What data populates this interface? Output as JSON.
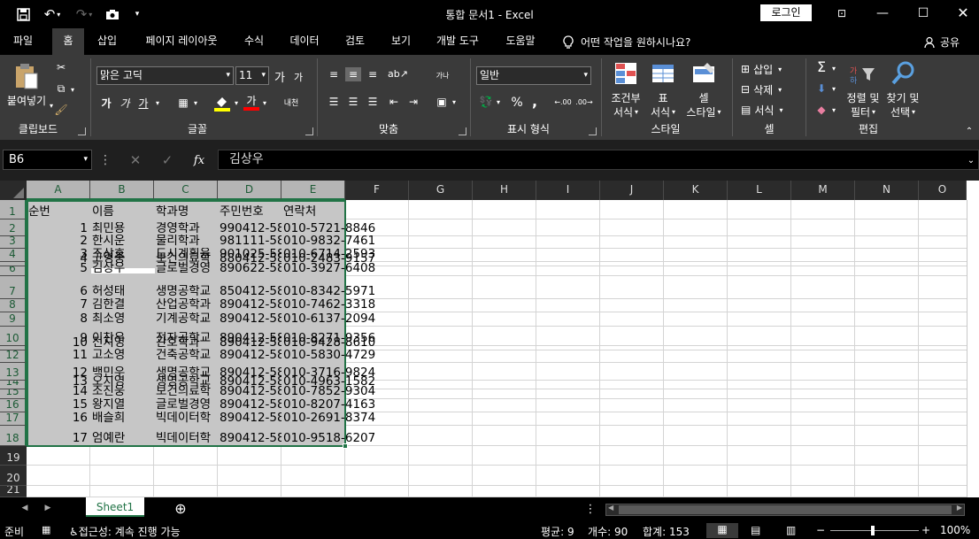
{
  "titlebar": {
    "title": "통합 문서1  -  Excel",
    "login": "로그인",
    "icons": [
      "save-icon",
      "undo-icon",
      "redo-icon",
      "camera-icon",
      "customize-qat-icon",
      "ribbon-display-icon",
      "minimize-icon",
      "maximize-icon",
      "close-icon"
    ]
  },
  "tabs": [
    "파일",
    "홈",
    "삽입",
    "페이지 레이아웃",
    "수식",
    "데이터",
    "검토",
    "보기",
    "개발 도구",
    "도움말"
  ],
  "active_tab": "홈",
  "tellme": "어떤 작업을 원하시나요?",
  "share": "공유",
  "ribbon": {
    "clipboard": {
      "paste": "붙여넣기",
      "label": "클립보드"
    },
    "font": {
      "name": "맑은 고딕",
      "size": "11",
      "label": "글꼴",
      "grow": "가",
      "shrink": "가",
      "bold": "가",
      "italic": "가",
      "underline": "가",
      "fontcolor": "가",
      "phonetic": "내천"
    },
    "alignment": {
      "label": "맞춤",
      "wrap": "가나"
    },
    "number": {
      "format": "일반",
      "label": "표시 형식",
      "percent": "%",
      "comma": ","
    },
    "styles": {
      "label": "스타일",
      "conditional": [
        "조건부",
        "서식"
      ],
      "table": [
        "표",
        "서식"
      ],
      "cellstyle": [
        "셀",
        "스타일"
      ]
    },
    "cells": {
      "label": "셀",
      "insert": "삽입",
      "delete": "삭제",
      "format": "서식"
    },
    "editing": {
      "label": "편집",
      "sortfilter": [
        "정렬 및",
        "필터"
      ],
      "findselect": [
        "찾기 및",
        "선택"
      ]
    },
    "accent": "#217346"
  },
  "formula_bar": {
    "namebox": "B6",
    "fx": "fx",
    "content": "김상우"
  },
  "grid": {
    "columns": [
      "A",
      "B",
      "C",
      "D",
      "E",
      "F",
      "G",
      "H",
      "I",
      "J",
      "K",
      "L",
      "M",
      "N",
      "O"
    ],
    "rows": [
      "1",
      "2",
      "3",
      "4",
      "5",
      "6",
      "7",
      "8",
      "9",
      "10",
      "11",
      "12",
      "13",
      "14",
      "15",
      "16",
      "17",
      "18",
      "19",
      "20",
      "21"
    ],
    "cells": [
      {
        "row": 1,
        "a": "순번",
        "b": "이름",
        "c": "학과명",
        "d": "주민번호",
        "e": "연락처"
      },
      {
        "row": 2,
        "a": "1",
        "b": "최민용",
        "c": "경영학과",
        "d": "990412-58",
        "e": "010-5721-8846"
      },
      {
        "row": 3,
        "a": "2",
        "b": "한시운",
        "c": "물리학과",
        "d": "981111-58",
        "e": "010-9832-7461"
      },
      {
        "row": 4,
        "a": "3",
        "b": "조상호",
        "c": "도시계획융",
        "d": "901025-58",
        "e": "010-6714-2593"
      },
      {
        "row": 5,
        "a": "4",
        "b": "고영중",
        "c": "보건의료학",
        "d": "880412-58",
        "e": "010-2483-9157"
      },
      {
        "row": 6,
        "a": "5",
        "b": "김상우",
        "c": "글로벌경영",
        "d": "890622-58",
        "e": "010-3927-6408"
      },
      {
        "row": 7,
        "a": "6",
        "b": "허성태",
        "c": "생명공학교",
        "d": "850412-58",
        "e": "010-8342-5971"
      },
      {
        "row": 8,
        "a": "7",
        "b": "김한결",
        "c": "산업공학과",
        "d": "890412-58",
        "e": "010-7462-3318"
      },
      {
        "row": 9,
        "a": "8",
        "b": "최소영",
        "c": "기계공학교",
        "d": "890412-58",
        "e": "010-6137-2094"
      },
      {
        "row": 10,
        "a": "9",
        "b": "이찬우",
        "c": "전자공학교",
        "d": "890412-58",
        "e": "010-8271-9356"
      },
      {
        "row": 11,
        "a": "10",
        "b": "전지영",
        "c": "간호학과",
        "d": "890412-58",
        "e": "010-9428-8610"
      },
      {
        "row": 12,
        "a": "11",
        "b": "고소영",
        "c": "건축공학교",
        "d": "890412-58",
        "e": "010-5830-4729"
      },
      {
        "row": 13,
        "a": "12",
        "b": "백민우",
        "c": "생명공학교",
        "d": "890412-58",
        "e": "010-3716-9824"
      },
      {
        "row": 14,
        "a": "13",
        "b": "오지영",
        "c": "생명공학교",
        "d": "890412-58",
        "e": "010-4963-1582"
      },
      {
        "row": 15,
        "a": "14",
        "b": "조진웅",
        "c": "보건의료학",
        "d": "890412-58",
        "e": "010-7852-9304"
      },
      {
        "row": 16,
        "a": "15",
        "b": "왕지열",
        "c": "글로벌경영",
        "d": "890412-58",
        "e": "010-8207-4163"
      },
      {
        "row": 17,
        "a": "16",
        "b": "배슬희",
        "c": "빅데이터학",
        "d": "890412-58",
        "e": "010-2691-8374"
      },
      {
        "row": 18,
        "a": "17",
        "b": "엄예란",
        "c": "빅데이터학",
        "d": "890412-58",
        "e": "010-9518-6207"
      }
    ]
  },
  "sheets": {
    "active": "Sheet1"
  },
  "status": {
    "mode": "준비",
    "accessibility": "접근성: 계속 진행 가능",
    "average": "평균: 9",
    "count": "개수: 90",
    "sum": "합계: 153",
    "zoom": "100%",
    "zoom_minus": "−",
    "zoom_plus": "+"
  }
}
